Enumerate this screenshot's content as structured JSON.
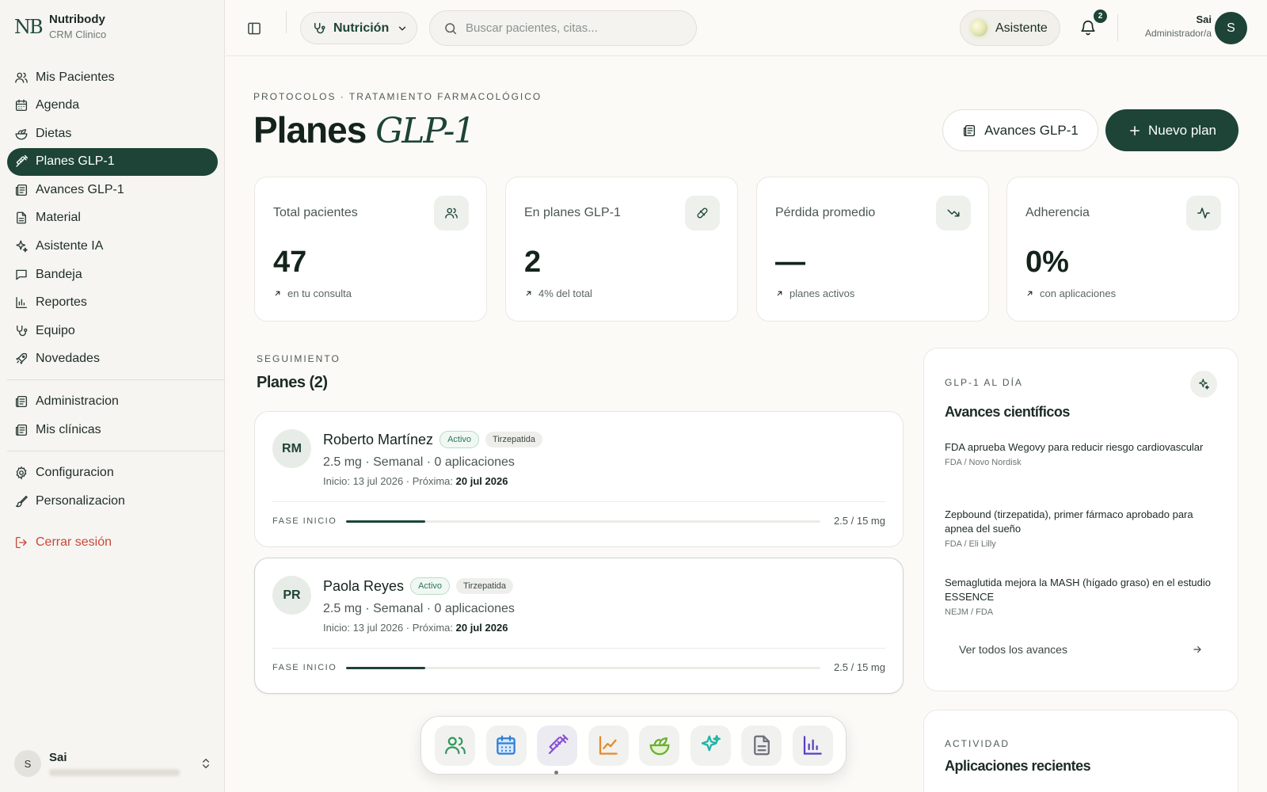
{
  "brand": {
    "mark": "NB",
    "name": "Nutribody",
    "subtitle": "CRM Clinico"
  },
  "sidebar": {
    "items": [
      {
        "label": "Mis Pacientes",
        "icon": "users-icon"
      },
      {
        "label": "Agenda",
        "icon": "calendar-icon"
      },
      {
        "label": "Dietas",
        "icon": "salad-icon"
      },
      {
        "label": "Planes GLP-1",
        "icon": "syringe-icon",
        "active": true
      },
      {
        "label": "Avances GLP-1",
        "icon": "newspaper-icon"
      },
      {
        "label": "Material",
        "icon": "document-icon"
      },
      {
        "label": "Asistente IA",
        "icon": "sparkles-icon"
      },
      {
        "label": "Bandeja",
        "icon": "message-icon"
      },
      {
        "label": "Reportes",
        "icon": "bar-chart-icon"
      },
      {
        "label": "Equipo",
        "icon": "stethoscope-icon"
      },
      {
        "label": "Novedades",
        "icon": "rocket-icon"
      }
    ],
    "admin_items": [
      {
        "label": "Administracion",
        "icon": "newspaper-icon"
      },
      {
        "label": "Mis clínicas",
        "icon": "newspaper-icon"
      }
    ],
    "settings_items": [
      {
        "label": "Configuracion",
        "icon": "gear-icon"
      },
      {
        "label": "Personalizacion",
        "icon": "brush-icon"
      }
    ],
    "logout_label": "Cerrar sesión",
    "user": {
      "initial": "S",
      "name": "Sai"
    }
  },
  "topbar": {
    "specialty": "Nutrición",
    "search_placeholder": "Buscar pacientes, citas...",
    "assistant_label": "Asistente",
    "notifications_count": "2",
    "user_name": "Sai",
    "user_role": "Administrador/a",
    "user_initial": "S"
  },
  "header": {
    "eyebrow": "PROTOCOLOS · TRATAMIENTO FARMACOLÓGICO",
    "title": "Planes",
    "title_italic": "GLP-1",
    "secondary_button": "Avances GLP-1",
    "primary_button": "Nuevo plan"
  },
  "stats": [
    {
      "label": "Total pacientes",
      "value": "47",
      "sub": "en tu consulta",
      "icon": "users-icon"
    },
    {
      "label": "En planes GLP-1",
      "value": "2",
      "sub": "4% del total",
      "icon": "pill-icon"
    },
    {
      "label": "Pérdida promedio",
      "value": "—",
      "sub": "planes activos",
      "icon": "trending-down-icon"
    },
    {
      "label": "Adherencia",
      "value": "0%",
      "sub": "con aplicaciones",
      "icon": "activity-icon"
    }
  ],
  "plans_section": {
    "eyebrow": "SEGUIMIENTO",
    "title": "Planes (2)",
    "plans": [
      {
        "initials": "RM",
        "name": "Roberto Martínez",
        "status": "Activo",
        "drug": "Tirzepatida",
        "dose": "2.5 mg · Semanal · 0 aplicaciones",
        "start_label": "Inicio: 13 jul 2026 · Próxima:",
        "next_date": "20 jul 2026",
        "phase": "FASE INICIO",
        "progress": 0.1667,
        "mg": "2.5 / 15 mg"
      },
      {
        "initials": "PR",
        "name": "Paola Reyes",
        "status": "Activo",
        "drug": "Tirzepatida",
        "dose": "2.5 mg · Semanal · 0 aplicaciones",
        "start_label": "Inicio: 13 jul 2026 · Próxima:",
        "next_date": "20 jul 2026",
        "phase": "FASE INICIO",
        "progress": 0.1667,
        "mg": "2.5 / 15 mg"
      }
    ]
  },
  "news": {
    "eyebrow": "GLP-1 AL DÍA",
    "title": "Avances científicos",
    "items": [
      {
        "title": "FDA aprueba Wegovy para reducir riesgo cardiovascular",
        "source": "FDA / Novo Nordisk"
      },
      {
        "title": "Zepbound (tirzepatida), primer fármaco aprobado para apnea del sueño",
        "source": "FDA / Eli Lilly"
      },
      {
        "title": "Semaglutida mejora la MASH (hígado graso) en el estudio ESSENCE",
        "source": "NEJM / FDA"
      }
    ],
    "link": "Ver todos los avances"
  },
  "activity": {
    "eyebrow": "ACTIVIDAD",
    "title": "Aplicaciones recientes"
  },
  "dock": [
    {
      "icon": "users-icon",
      "color": "#2e9a5c"
    },
    {
      "icon": "calendar-icon",
      "color": "#2f7fd6"
    },
    {
      "icon": "syringe-icon",
      "color": "#8a4fd8",
      "active": true
    },
    {
      "icon": "line-chart-icon",
      "color": "#e58a2a"
    },
    {
      "icon": "salad-icon",
      "color": "#69b02e"
    },
    {
      "icon": "sparkles-icon",
      "color": "#20b3a6"
    },
    {
      "icon": "document-icon",
      "color": "#6b6f78"
    },
    {
      "icon": "bar-chart-icon",
      "color": "#5a3fc4"
    }
  ],
  "colors": {
    "brand": "#1d4436",
    "danger": "#c8483a",
    "background": "#fbfaf7"
  }
}
